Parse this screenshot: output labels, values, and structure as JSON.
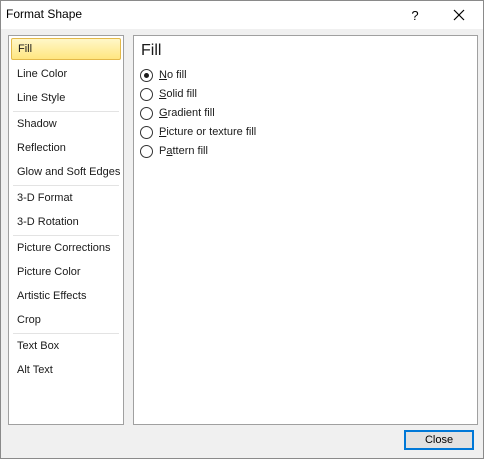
{
  "window": {
    "title": "Format Shape",
    "help_label": "?",
    "close_icon": "close-icon"
  },
  "sidebar": {
    "items": [
      {
        "label": "Fill",
        "selected": true
      },
      {
        "label": "Line Color"
      },
      {
        "label": "Line Style"
      },
      {
        "label": "Shadow"
      },
      {
        "label": "Reflection"
      },
      {
        "label": "Glow and Soft Edges"
      },
      {
        "label": "3-D Format"
      },
      {
        "label": "3-D Rotation"
      },
      {
        "label": "Picture Corrections"
      },
      {
        "label": "Picture Color"
      },
      {
        "label": "Artistic Effects"
      },
      {
        "label": "Crop"
      },
      {
        "label": "Text Box"
      },
      {
        "label": "Alt Text"
      }
    ]
  },
  "panel": {
    "heading": "Fill",
    "options": [
      {
        "mnemonic": "N",
        "rest": "o fill",
        "checked": true
      },
      {
        "mnemonic": "S",
        "rest": "olid fill",
        "checked": false
      },
      {
        "mnemonic": "G",
        "rest": "radient fill",
        "checked": false
      },
      {
        "mnemonic": "P",
        "rest": "icture or texture fill",
        "checked": false
      },
      {
        "pre": "P",
        "mnemonic": "a",
        "rest": "ttern fill",
        "checked": false
      }
    ]
  },
  "footer": {
    "close_label": "Close"
  },
  "colors": {
    "selected_bg": "#ffe680",
    "selected_border": "#e3b94a",
    "focus_border": "#0078d7"
  }
}
